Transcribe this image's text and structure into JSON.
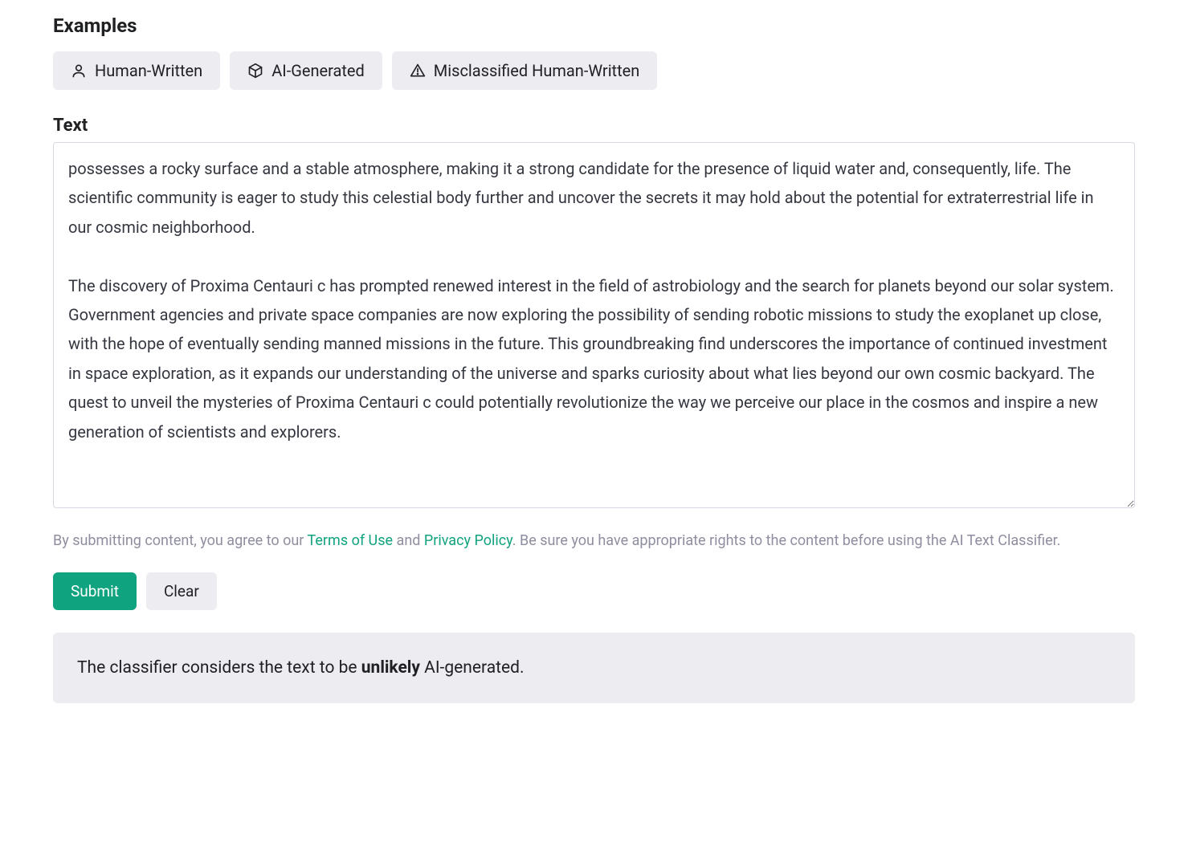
{
  "sections": {
    "examples_title": "Examples",
    "text_label": "Text"
  },
  "examples": {
    "human": "Human-Written",
    "ai": "AI-Generated",
    "misclassified": "Misclassified Human-Written"
  },
  "text_value": "possesses a rocky surface and a stable atmosphere, making it a strong candidate for the presence of liquid water and, consequently, life. The scientific community is eager to study this celestial body further and uncover the secrets it may hold about the potential for extraterrestrial life in our cosmic neighborhood.\n\nThe discovery of Proxima Centauri c has prompted renewed interest in the field of astrobiology and the search for planets beyond our solar system. Government agencies and private space companies are now exploring the possibility of sending robotic missions to study the exoplanet up close, with the hope of eventually sending manned missions in the future. This groundbreaking find underscores the importance of continued investment in space exploration, as it expands our understanding of the universe and sparks curiosity about what lies beyond our own cosmic backyard. The quest to unveil the mysteries of Proxima Centauri c could potentially revolutionize the way we perceive our place in the cosmos and inspire a new generation of scientists and explorers.",
  "legal": {
    "prefix": "By submitting content, you agree to our ",
    "terms": "Terms of Use",
    "and": " and ",
    "privacy": "Privacy Policy",
    "suffix": ". Be sure you have appropriate rights to the content before using the AI Text Classifier."
  },
  "actions": {
    "submit": "Submit",
    "clear": "Clear"
  },
  "result": {
    "prefix": "The classifier considers the text to be ",
    "verdict": "unlikely",
    "suffix": " AI-generated."
  },
  "colors": {
    "accent": "#10a37f",
    "panel": "#ececf1",
    "muted": "#8e8ea0"
  }
}
